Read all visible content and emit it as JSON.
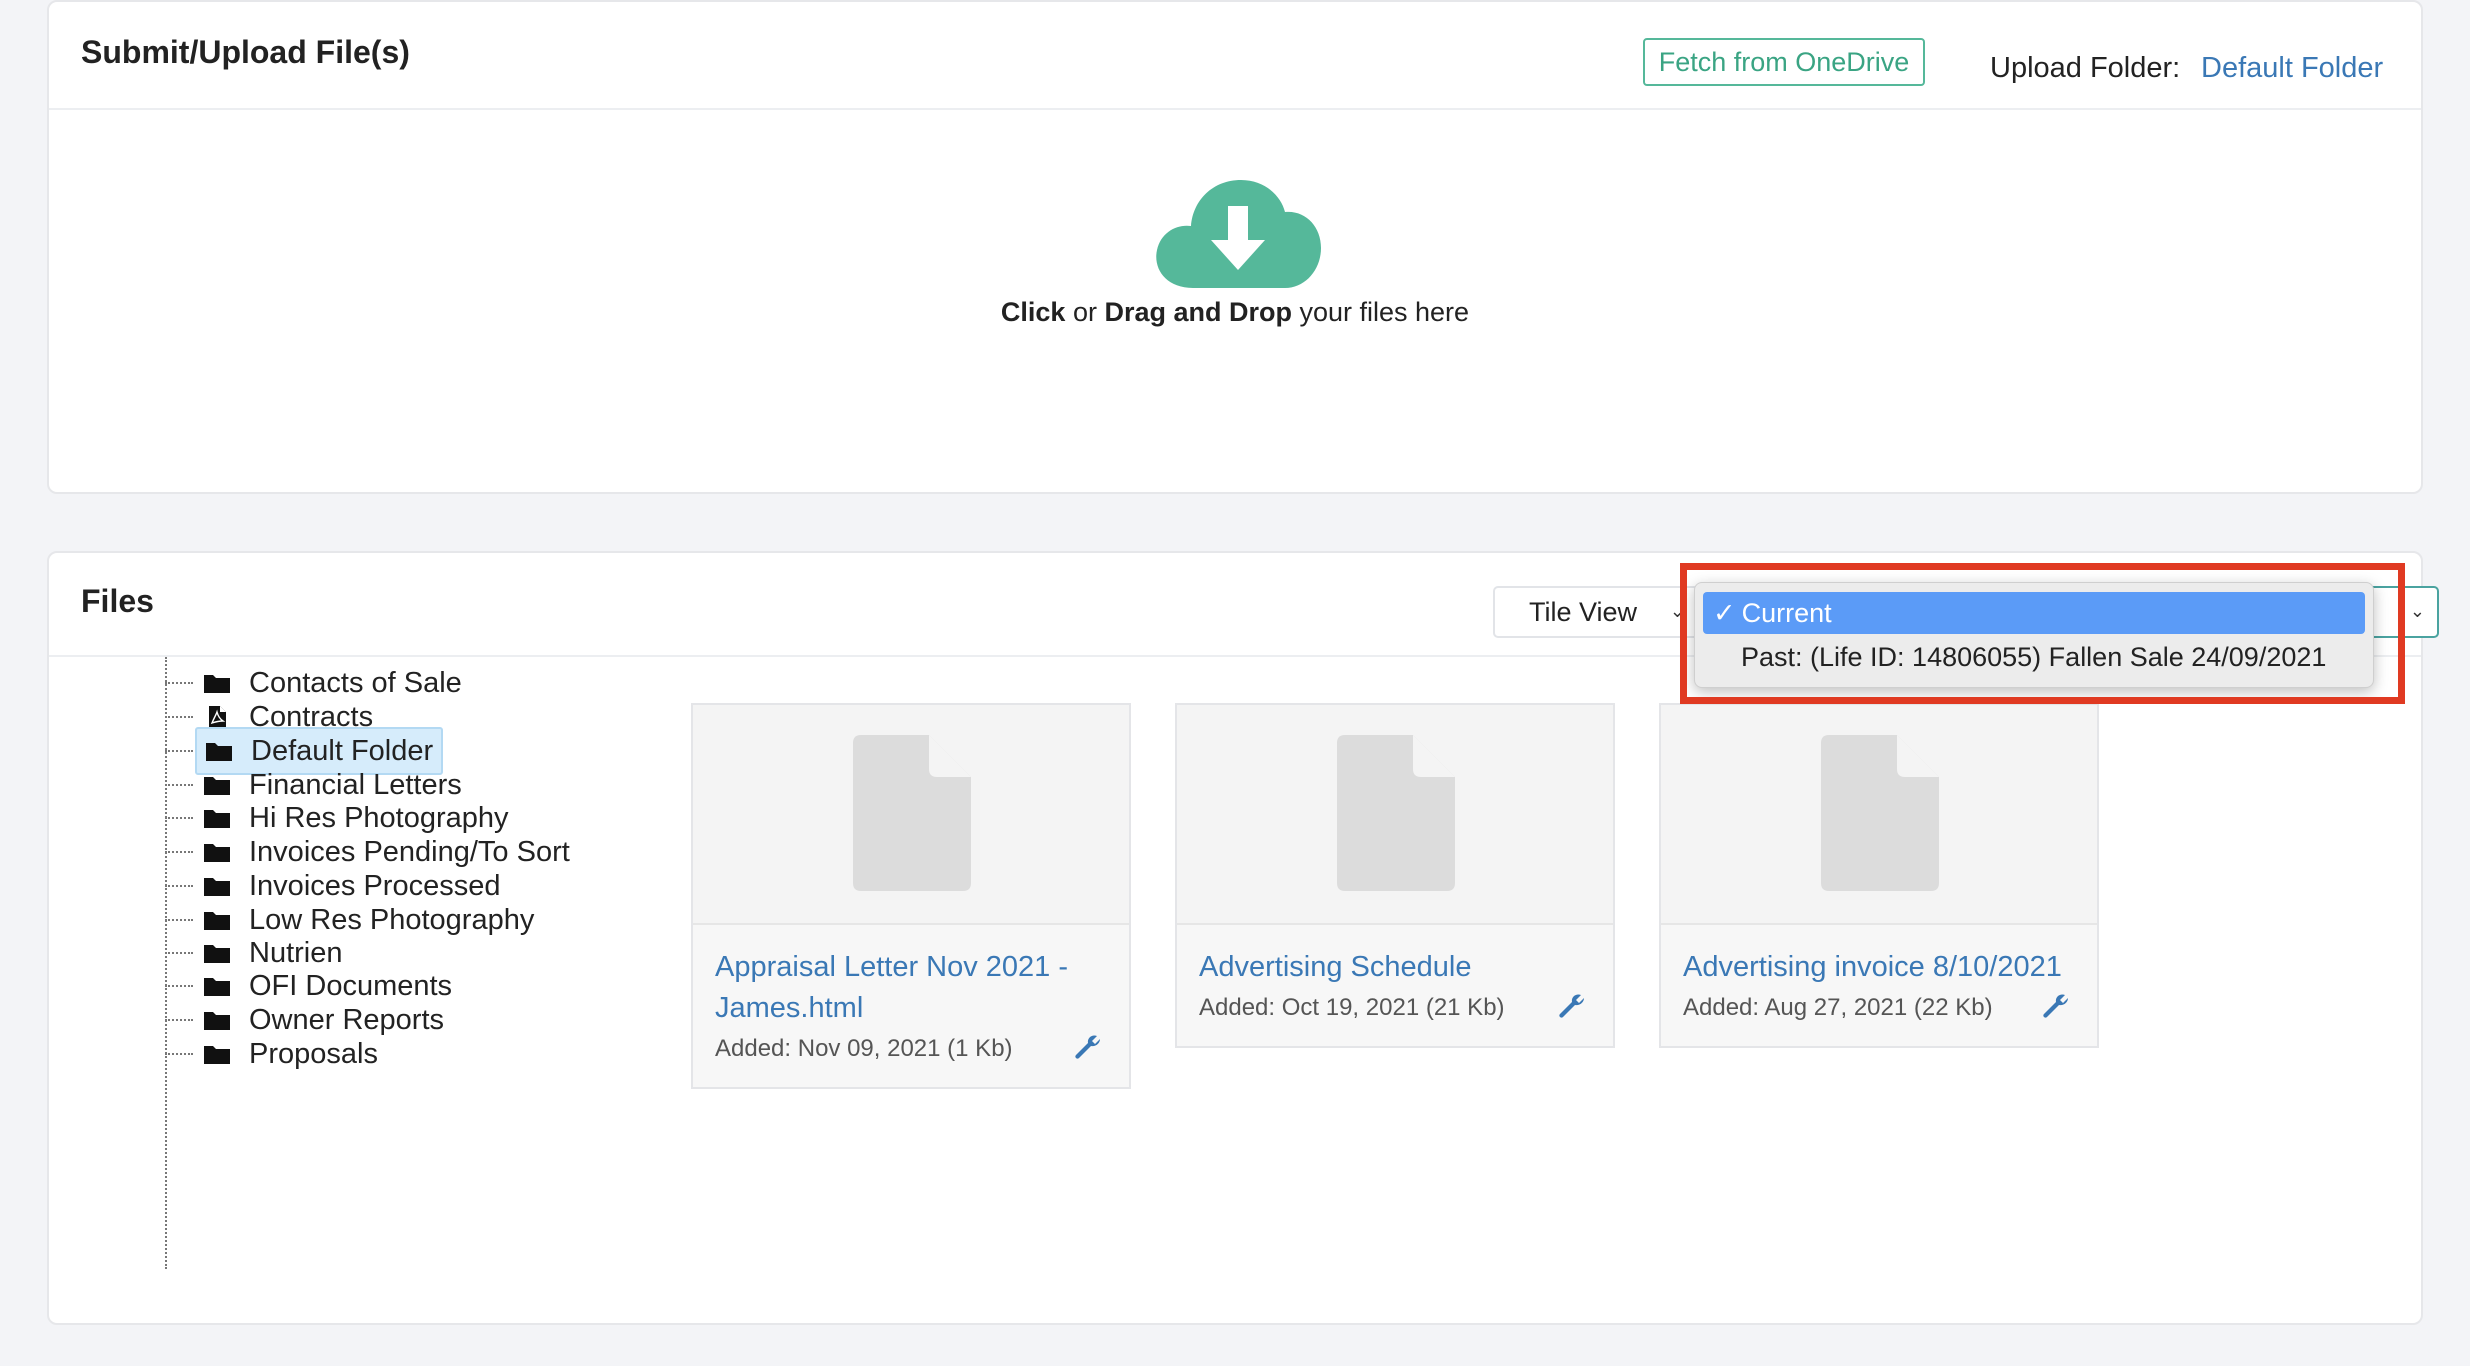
{
  "upload_panel": {
    "title": "Submit/Upload File(s)",
    "onedrive_button": "Fetch from OneDrive",
    "folder_label": "Upload Folder:",
    "folder_value": "Default Folder",
    "drop_click": "Click",
    "drop_or": " or ",
    "drop_drag": "Drag and Drop",
    "drop_rest": " your files here"
  },
  "files_panel": {
    "title": "Files",
    "view_select": "Tile View",
    "version_dropdown": {
      "selected": "Current",
      "check": "✓",
      "other": "Past: (Life ID: 14806055) Fallen Sale 24/09/2021"
    },
    "folders": [
      {
        "label": "Contacts of Sale",
        "icon": "folder-icon"
      },
      {
        "label": "Contracts",
        "icon": "pdf-file-icon"
      },
      {
        "label": "Default Folder",
        "icon": "folder-icon",
        "selected": true
      },
      {
        "label": "Financial Letters",
        "icon": "folder-icon"
      },
      {
        "label": "Hi Res Photography",
        "icon": "folder-icon"
      },
      {
        "label": "Invoices Pending/To Sort",
        "icon": "folder-icon"
      },
      {
        "label": "Invoices Processed",
        "icon": "folder-icon"
      },
      {
        "label": "Low Res Photography",
        "icon": "folder-icon"
      },
      {
        "label": "Nutrien",
        "icon": "folder-icon"
      },
      {
        "label": "OFI Documents",
        "icon": "folder-icon"
      },
      {
        "label": "Owner Reports",
        "icon": "folder-icon"
      },
      {
        "label": "Proposals",
        "icon": "folder-icon"
      }
    ],
    "files": [
      {
        "name": "Appraisal Letter Nov 2021 - James.html",
        "meta": "Added: Nov 09, 2021 (1 Kb)"
      },
      {
        "name": "Advertising Schedule",
        "meta": "Added: Oct 19, 2021 (21 Kb)"
      },
      {
        "name": "Advertising invoice 8/10/2021",
        "meta": "Added: Aug 27, 2021 (22 Kb)"
      }
    ]
  },
  "colors": {
    "accent_green": "#55b89a",
    "link_blue": "#3a78b5",
    "highlight_red": "#e03a22",
    "selected_option": "#5b9bf7"
  }
}
